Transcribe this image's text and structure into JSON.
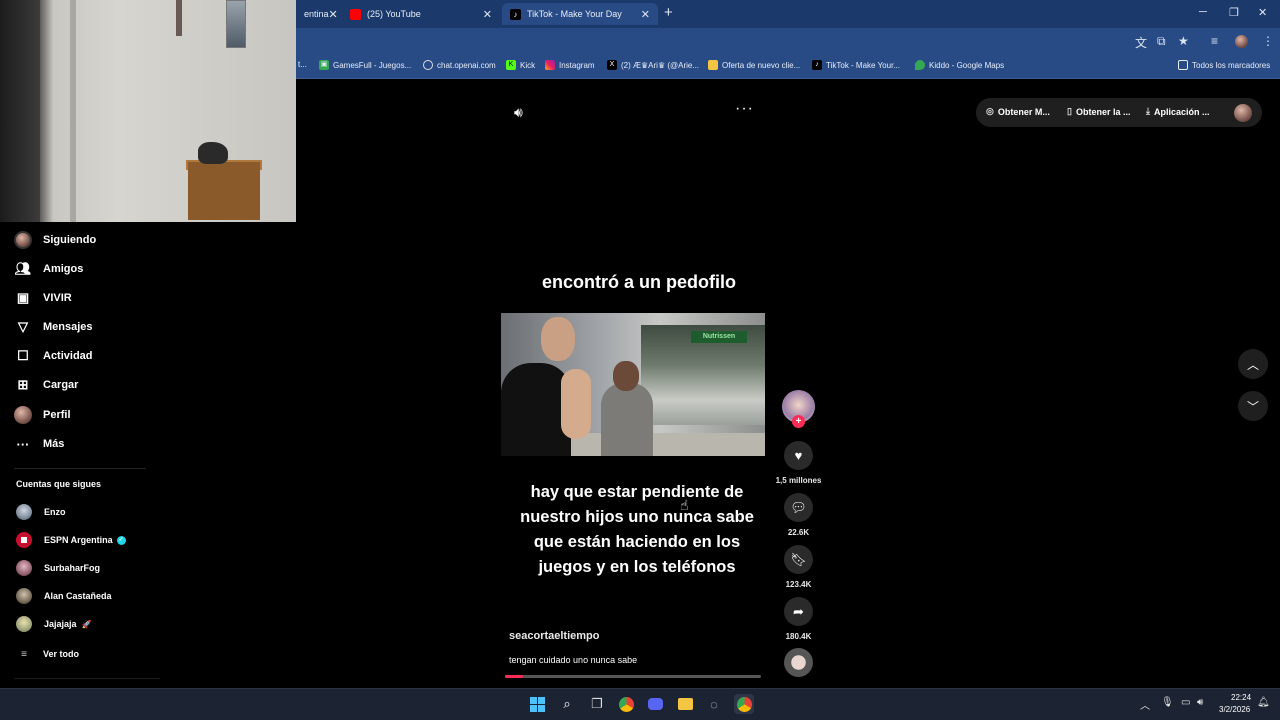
{
  "browser": {
    "tabs": [
      {
        "label": "entina",
        "active": false
      },
      {
        "label": "(25) YouTube",
        "active": false
      },
      {
        "label": "TikTok - Make Your Day",
        "active": true
      }
    ],
    "new_tab": "+",
    "window_controls": [
      "─",
      "❐",
      "✕"
    ],
    "bookmarks": [
      {
        "label": "t...",
        "icon": "bookmark-icon"
      },
      {
        "label": "GamesFull - Juegos...",
        "icon": "gamepad-icon"
      },
      {
        "label": "chat.openai.com",
        "icon": "openai-icon"
      },
      {
        "label": "Kick",
        "icon": "kick-icon"
      },
      {
        "label": "Instagram",
        "icon": "instagram-icon"
      },
      {
        "label": "(2) Æ♛Ari♛ (@Arie...",
        "icon": "x-icon"
      },
      {
        "label": "Oferta de nuevo clie...",
        "icon": "offer-icon"
      },
      {
        "label": "TikTok - Make Your...",
        "icon": "tiktok-icon"
      },
      {
        "label": "Kiddo - Google Maps",
        "icon": "maps-icon"
      }
    ],
    "all_bookmarks": "Todos los marcadores"
  },
  "sidebar": {
    "nav": [
      {
        "label": "Siguiendo",
        "icon": "following-avatar-icon"
      },
      {
        "label": "Amigos",
        "icon": "friends-icon"
      },
      {
        "label": "VIVIR",
        "icon": "live-icon"
      },
      {
        "label": "Mensajes",
        "icon": "messages-icon"
      },
      {
        "label": "Actividad",
        "icon": "activity-icon"
      },
      {
        "label": "Cargar",
        "icon": "upload-icon"
      },
      {
        "label": "Perfil",
        "icon": "profile-avatar-icon"
      },
      {
        "label": "Más",
        "icon": "more-icon"
      }
    ],
    "following_heading": "Cuentas que sigues",
    "accounts": [
      {
        "name": "Enzo",
        "verified": false,
        "badge": ""
      },
      {
        "name": "ESPN Argentina",
        "verified": true,
        "badge": ""
      },
      {
        "name": "SurbaharFog",
        "verified": false,
        "badge": ""
      },
      {
        "name": "Alan Castañeda",
        "verified": false,
        "badge": ""
      },
      {
        "name": "Jajajaja",
        "verified": false,
        "badge": "🚀"
      }
    ],
    "see_all": "Ver todo"
  },
  "header": {
    "get_coins": "Obtener M...",
    "get_app": "Obtener la ...",
    "pc_app": "Aplicación ..."
  },
  "video": {
    "title": "encontró a un pedofilo",
    "sign_text": "Nutrissen",
    "caption": "hay que estar pendiente de nuestro hijos uno nunca sabe que están haciendo en los juegos y en los teléfonos",
    "author": "seacortaeltiempo",
    "description": "tengan cuidado uno nunca sabe",
    "progress": 0.07
  },
  "actions": {
    "likes": "1,5 millones",
    "comments": "22.6K",
    "saves": "123.4K",
    "shares": "180.4K"
  },
  "taskbar": {
    "time": "22:24",
    "date": "3/2/2026"
  },
  "colors": {
    "accent": "#fe2c55",
    "tabbar": "#1b3a6b",
    "toolbar": "#284b86",
    "taskbar": "#1c2433"
  }
}
